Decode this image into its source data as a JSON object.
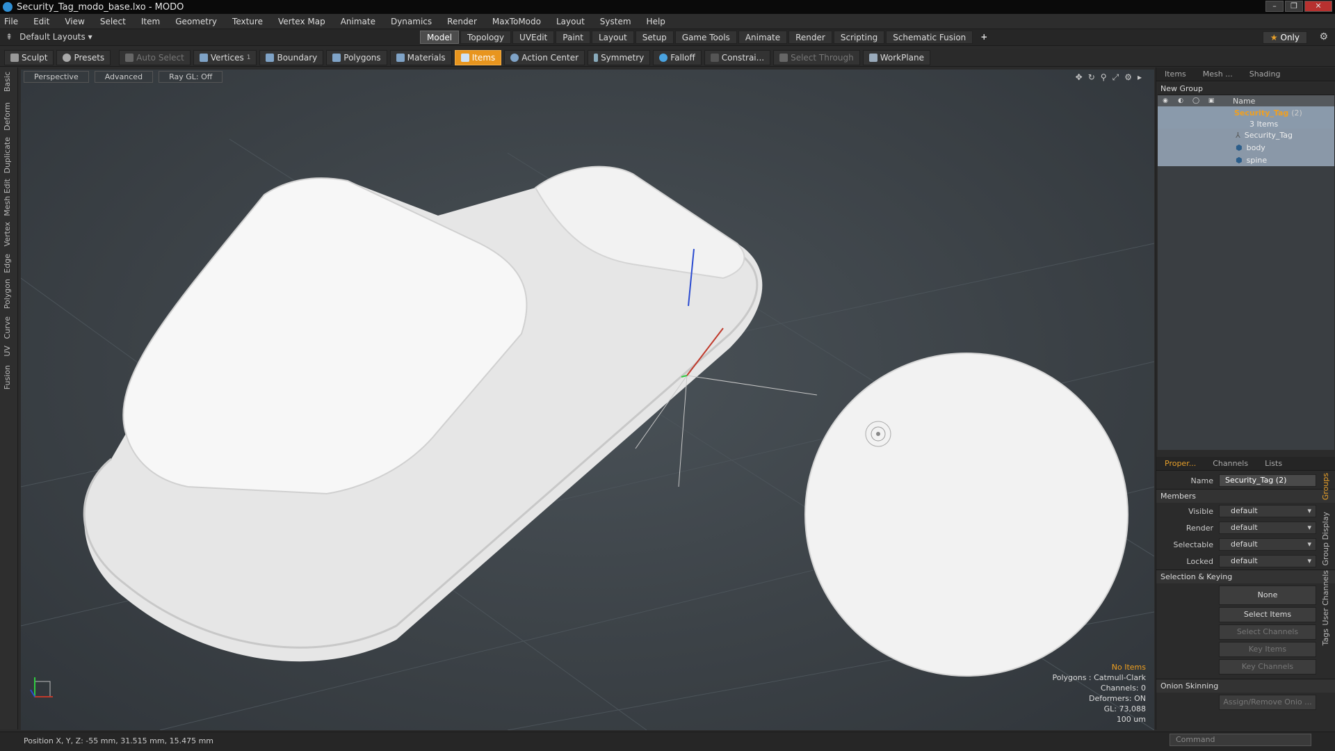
{
  "window": {
    "title": "Security_Tag_modo_base.lxo - MODO"
  },
  "menu": [
    "File",
    "Edit",
    "View",
    "Select",
    "Item",
    "Geometry",
    "Texture",
    "Vertex Map",
    "Animate",
    "Dynamics",
    "Render",
    "MaxToModo",
    "Layout",
    "System",
    "Help"
  ],
  "layoutbar": {
    "layouts_label": "Default Layouts ▾",
    "tabs": [
      "Model",
      "Topology",
      "UVEdit",
      "Paint",
      "Layout",
      "Setup",
      "Game Tools",
      "Animate",
      "Render",
      "Scripting",
      "Schematic Fusion"
    ],
    "active_tab": "Model",
    "add": "+",
    "only_star": "★",
    "only_label": "Only"
  },
  "toolbar": {
    "sculpt": "Sculpt",
    "presets": "Presets",
    "auto_select": "Auto Select",
    "vertices": "Vertices",
    "vertices_count": "1",
    "boundary": "Boundary",
    "polygons": "Polygons",
    "materials": "Materials",
    "items": "Items",
    "action_center": "Action Center",
    "symmetry": "Symmetry",
    "falloff": "Falloff",
    "constraints": "Constrai...",
    "select_through": "Select Through",
    "workplane": "WorkPlane"
  },
  "left_tabs": [
    "Basic",
    "Deform",
    "Duplicate",
    "Mesh Edit",
    "Vertex",
    "Edge",
    "Polygon",
    "Curve",
    "UV",
    "Fusion"
  ],
  "viewport": {
    "view_mode": "Perspective",
    "advanced": "Advanced",
    "raygl": "Ray GL: Off",
    "info": {
      "no_items": "No Items",
      "polygons": "Polygons : Catmull-Clark",
      "channels": "Channels: 0",
      "deformers": "Deformers: ON",
      "gl": "GL: 73,088",
      "scale": "100 um"
    }
  },
  "items_panel": {
    "tabs": [
      "Items",
      "Mesh ...",
      "Shading"
    ],
    "new_group": "New Group",
    "name_col": "Name",
    "group_name": "Security_Tag",
    "group_count": "(2)",
    "group_items": "3 Items",
    "children": [
      "Security_Tag",
      "body",
      "spine"
    ]
  },
  "properties": {
    "tabs": [
      "Proper...",
      "Channels",
      "Lists"
    ],
    "name_label": "Name",
    "name_value": "Security_Tag (2)",
    "members": "Members",
    "visible_label": "Visible",
    "visible_value": "default",
    "render_label": "Render",
    "render_value": "default",
    "selectable_label": "Selectable",
    "selectable_value": "default",
    "locked_label": "Locked",
    "locked_value": "default",
    "sel_keying": "Selection & Keying",
    "none": "None",
    "select_items": "Select Items",
    "select_channels": "Select Channels",
    "key_items": "Key Items",
    "key_channels": "Key Channels",
    "onion": "Onion Skinning",
    "assign_onion": "Assign/Remove Onio ...",
    "side_tabs": [
      "Groups",
      "Group Display",
      "User Channels",
      "Tags"
    ]
  },
  "status": {
    "position": "Position X, Y, Z:  -55 mm, 31.515 mm, 15.475 mm",
    "command_placeholder": "Command"
  }
}
